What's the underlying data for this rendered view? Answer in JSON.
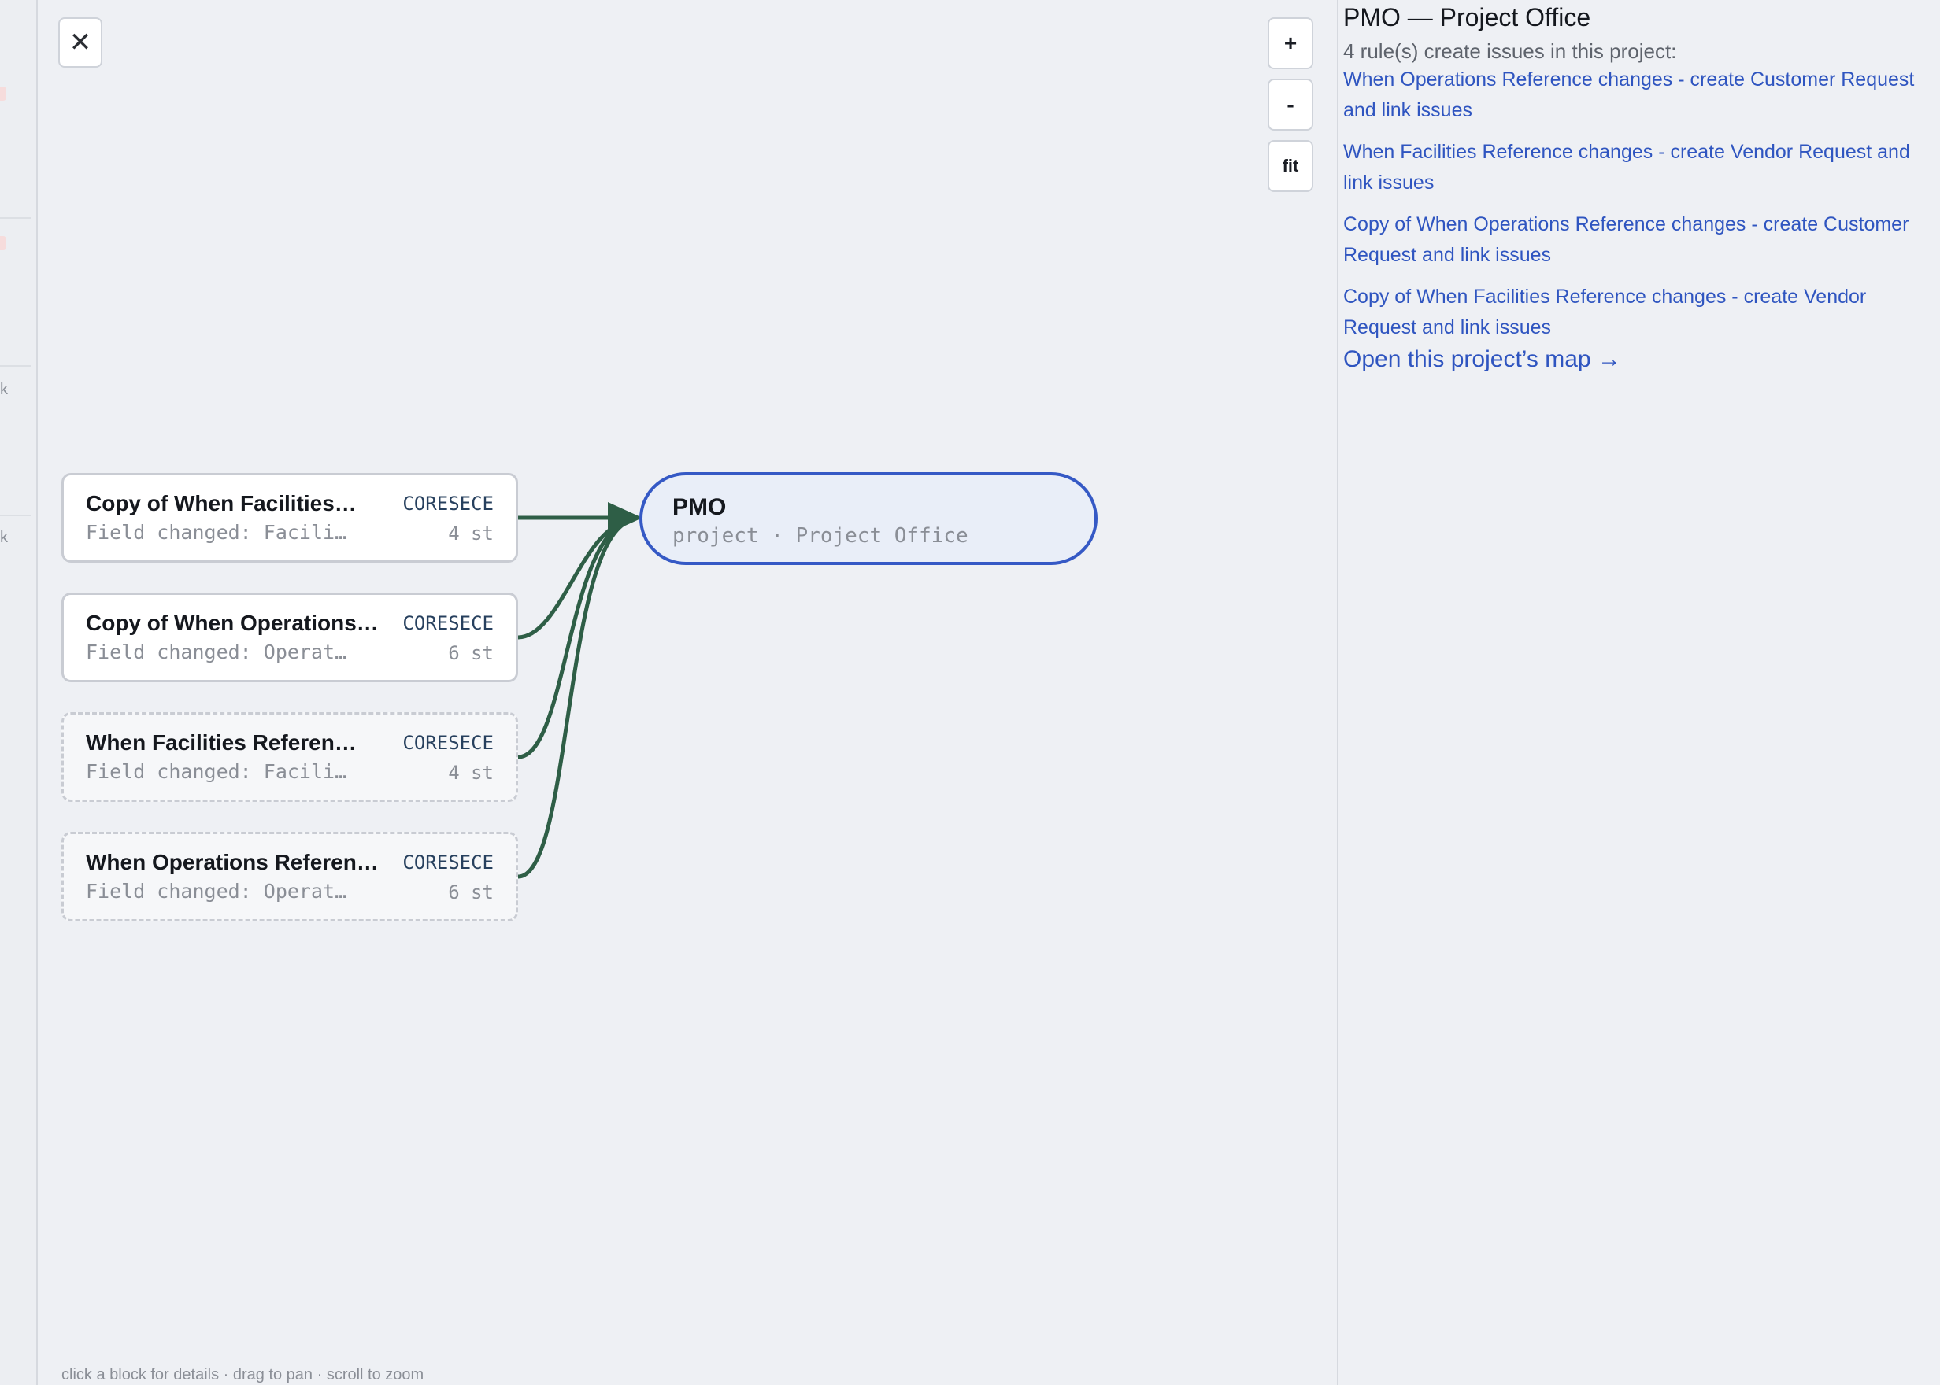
{
  "strip": {
    "k1": "k",
    "k2": "k"
  },
  "toolbar": {
    "close_glyph": "✕",
    "zoom_in": "+",
    "zoom_out": "-",
    "fit": "fit"
  },
  "rules": [
    {
      "title": "Copy of When Facilities…",
      "subtitle": "Field changed: Facili…",
      "project": "CORESECE",
      "steps": "4 st",
      "dashed": false
    },
    {
      "title": "Copy of When Operations…",
      "subtitle": "Field changed: Operat…",
      "project": "CORESECE",
      "steps": "6 st",
      "dashed": false
    },
    {
      "title": "When Facilities Referen…",
      "subtitle": "Field changed: Facili…",
      "project": "CORESECE",
      "steps": "4 st",
      "dashed": true
    },
    {
      "title": "When Operations Referen…",
      "subtitle": "Field changed: Operat…",
      "project": "CORESECE",
      "steps": "6 st",
      "dashed": true
    }
  ],
  "project_node": {
    "title": "PMO",
    "subtitle": "project · Project Office"
  },
  "colors": {
    "edge": "#2e5e46",
    "node_border": "#3559c5",
    "link": "#2f55c0"
  },
  "hint": "click a block for details · drag to pan · scroll to zoom",
  "panel": {
    "title": "PMO — Project Office",
    "count_text": "4 rule(s) create issues in this project:",
    "rule_links": [
      "When Operations Reference changes - create Customer Request and link issues",
      "When Facilities Reference changes - create Vendor Request and link issues",
      "Copy of When Operations Reference changes - create Customer Request and link issues",
      "Copy of When Facilities Reference changes - create Vendor Request and link issues"
    ],
    "open_map": "Open this project’s map →"
  }
}
